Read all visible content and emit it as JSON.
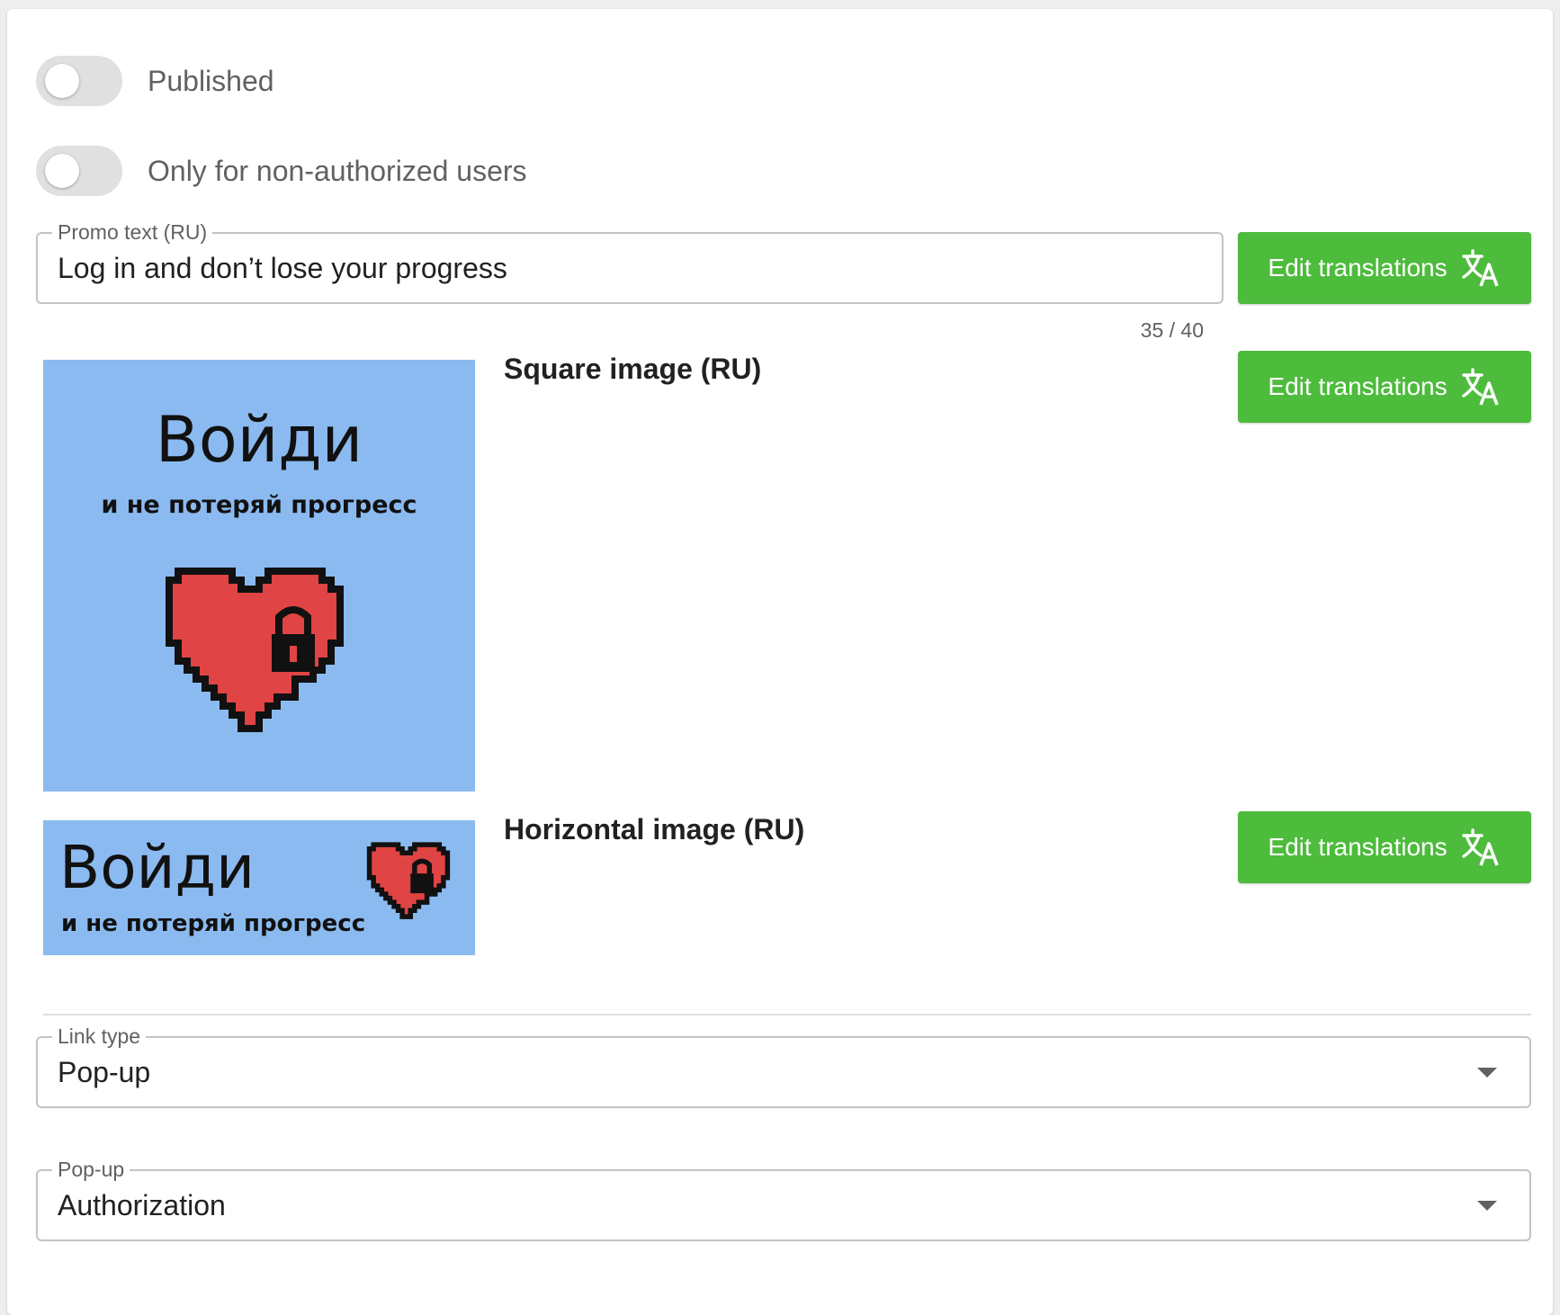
{
  "toggles": {
    "published": {
      "label": "Published",
      "checked": false
    },
    "non_authorized": {
      "label": "Only for non-authorized users",
      "checked": false
    }
  },
  "promo": {
    "legend": "Promo text (RU)",
    "value": "Log in and don’t lose your progress",
    "counter": "35 / 40",
    "button_label": "Edit translations"
  },
  "square_image": {
    "label": "Square image (RU)",
    "button_label": "Edit translations",
    "picture_title": "Войди",
    "picture_subtitle": "и не потеряй прогресс"
  },
  "horizontal_image": {
    "label": "Horizontal image (RU)",
    "button_label": "Edit translations",
    "picture_title": "Войди",
    "picture_subtitle": "и не потеряй прогресс"
  },
  "link_type": {
    "legend": "Link type",
    "value": "Pop-up"
  },
  "popup": {
    "legend": "Pop-up",
    "value": "Authorization"
  },
  "colors": {
    "accent": "#4dbb3c",
    "image_bg": "#8bbaf0",
    "heart": "#e04444"
  },
  "icons": {
    "translate": "translate-icon",
    "dropdown": "chevron-down-icon"
  }
}
